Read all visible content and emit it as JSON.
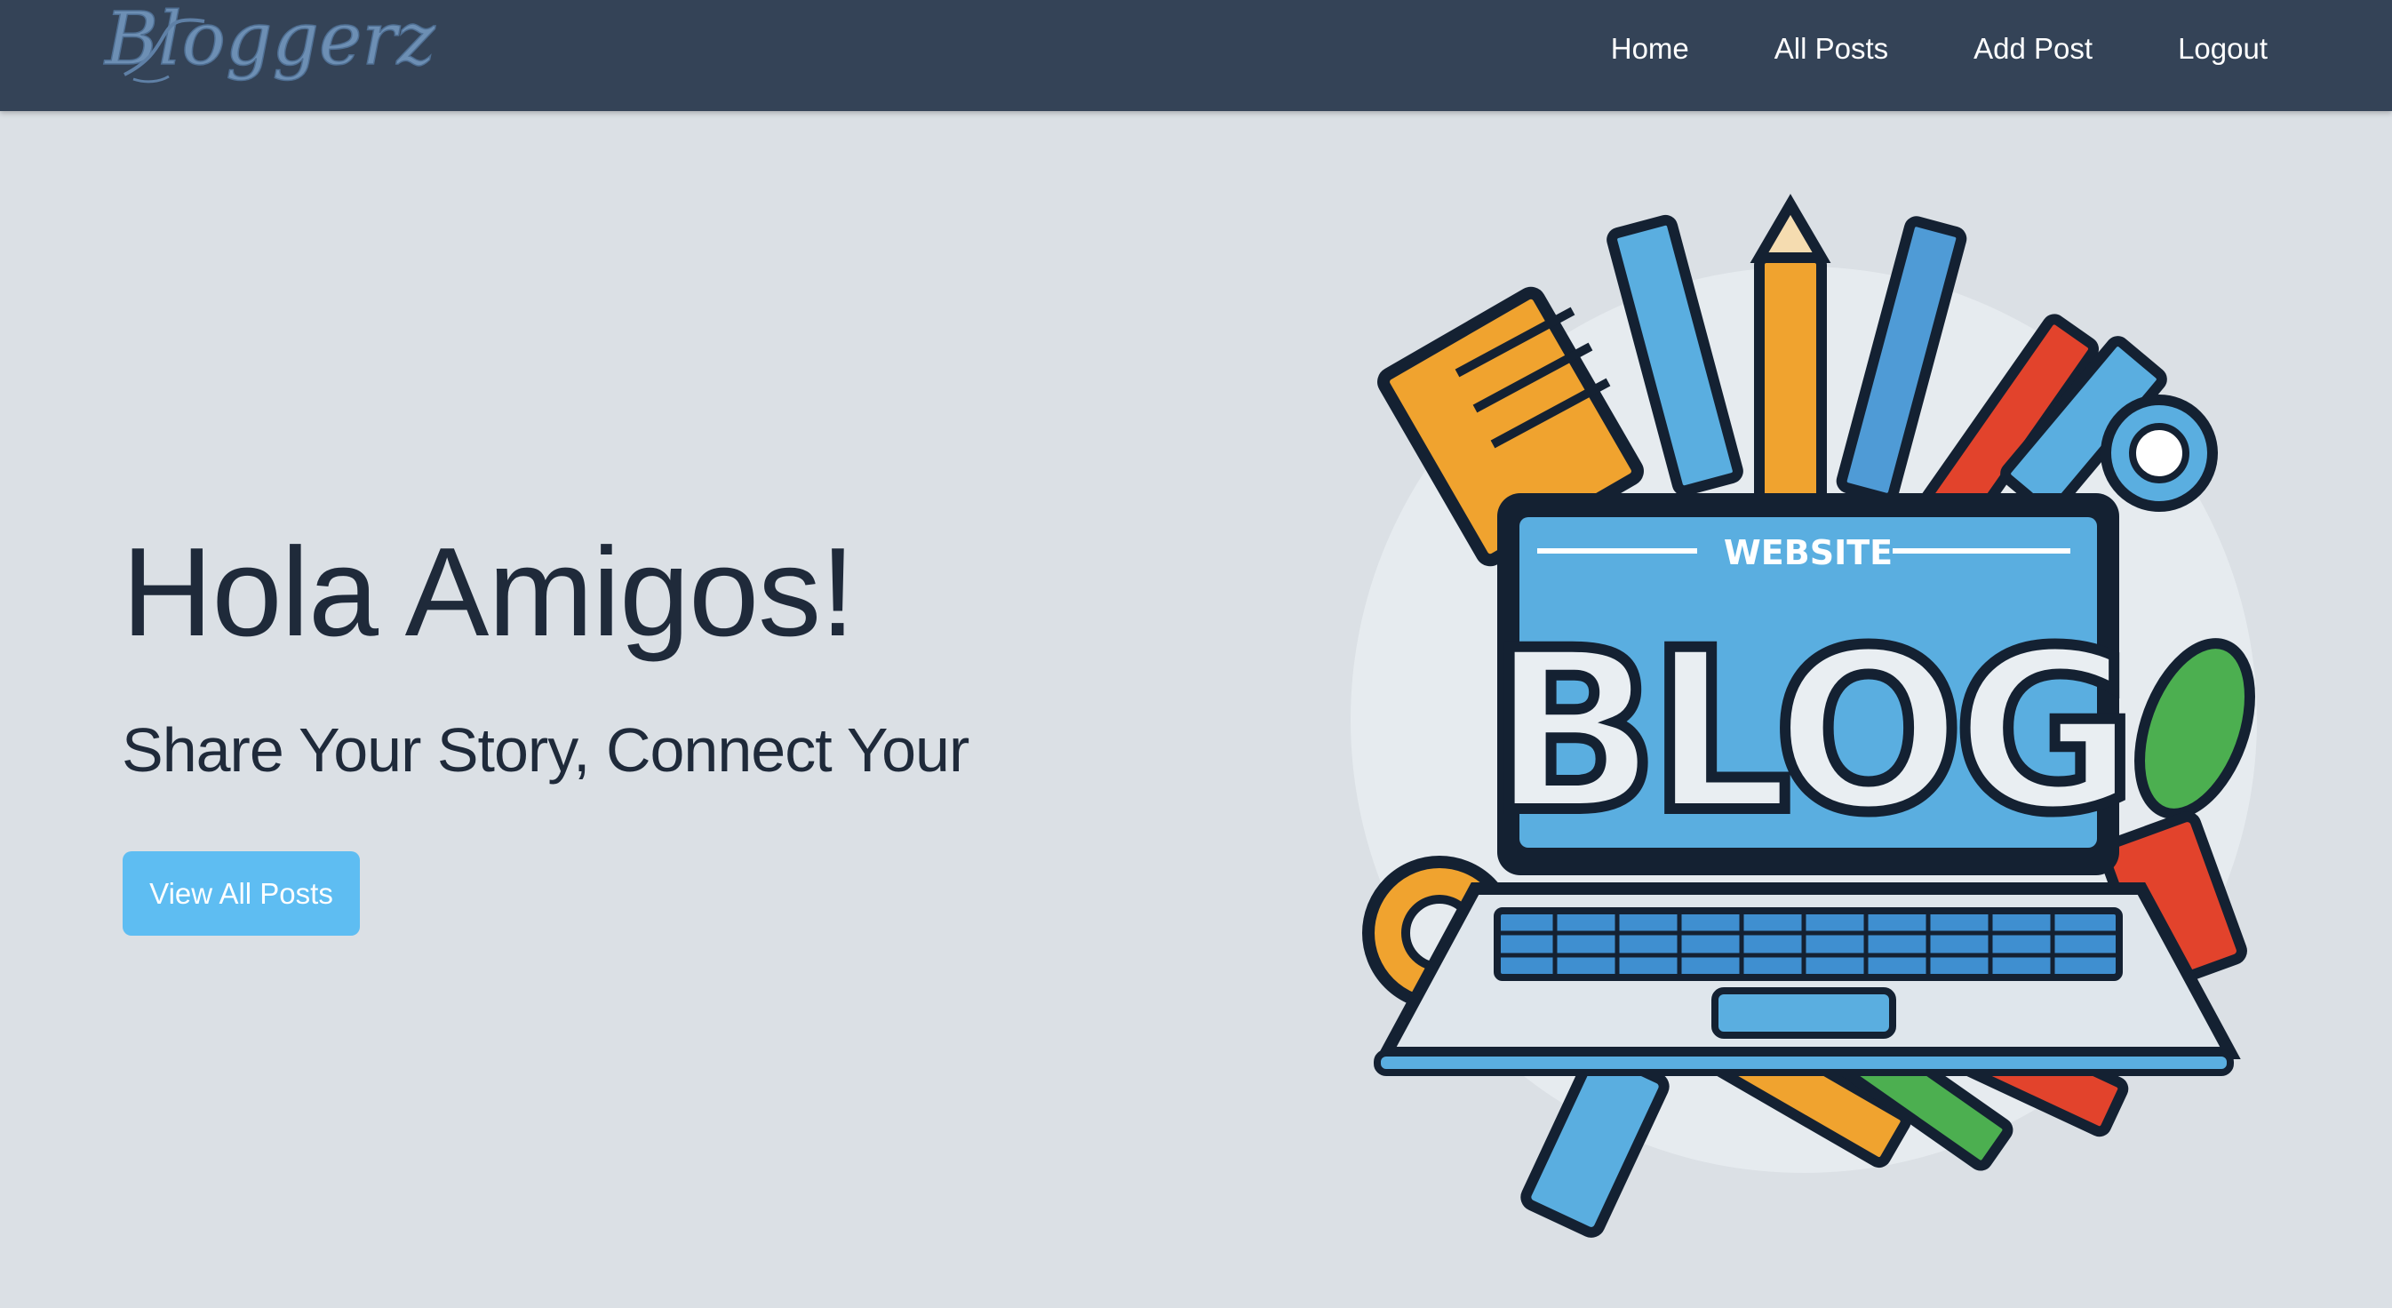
{
  "brand": {
    "logo_text": "Bloggerz"
  },
  "nav": {
    "items": [
      {
        "label": "Home"
      },
      {
        "label": "All Posts"
      },
      {
        "label": "Add Post"
      },
      {
        "label": "Logout"
      }
    ]
  },
  "hero": {
    "title": "Hola Amigos!",
    "subtitle": "Share Your Story, Connect Your",
    "cta_label": "View All Posts",
    "image": {
      "top_text": "WEBSITE",
      "main_text": "BLOG"
    }
  },
  "colors": {
    "navbar": "#344357",
    "background": "#dbe0e5",
    "accent": "#5ebdf2",
    "text": "#1f2a3a"
  }
}
